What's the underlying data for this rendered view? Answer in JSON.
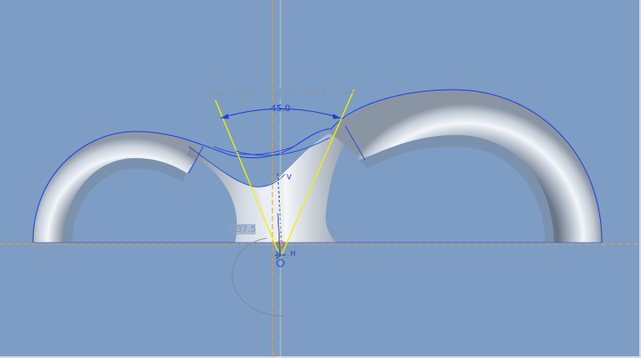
{
  "viewport": {
    "background": "#7d9dc4",
    "model_colors": {
      "highlight": "#f2f6fa",
      "mid": "#c4ccd6",
      "shadow": "#6c7786"
    },
    "edge_color": "#2040e0",
    "construction_color": "#e8a030",
    "sketch_color": "#f0f000"
  },
  "dimensions": {
    "left_width": "39.0",
    "right_width": "46.2",
    "angle": "45.0",
    "arc_value": "137.5"
  },
  "markers": {
    "vertex_label": "V",
    "ref_label": "H"
  }
}
